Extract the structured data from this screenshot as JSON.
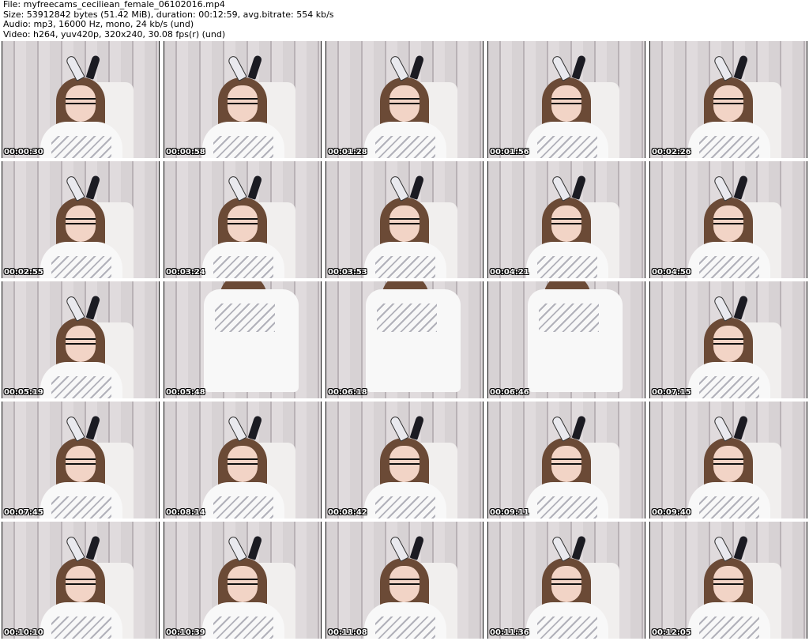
{
  "header": {
    "line1": "File: myfreecams_ceciliean_female_06102016.mp4",
    "line2": "Size: 53912842 bytes (51.42 MiB), duration: 00:12:59, avg.bitrate: 554 kb/s",
    "line3": "Audio: mp3, 16000 Hz, mono, 24 kb/s (und)",
    "line4": "Video: h264, yuv420p, 320x240, 30.08 fps(r) (und)"
  },
  "thumbnails": [
    {
      "time": "00:00:30",
      "pose": "seated"
    },
    {
      "time": "00:00:58",
      "pose": "seated"
    },
    {
      "time": "00:01:28",
      "pose": "seated"
    },
    {
      "time": "00:01:56",
      "pose": "seated"
    },
    {
      "time": "00:02:26",
      "pose": "seated"
    },
    {
      "time": "00:02:55",
      "pose": "seated"
    },
    {
      "time": "00:03:24",
      "pose": "seated"
    },
    {
      "time": "00:03:53",
      "pose": "seated"
    },
    {
      "time": "00:04:21",
      "pose": "seated"
    },
    {
      "time": "00:04:50",
      "pose": "seated"
    },
    {
      "time": "00:05:19",
      "pose": "seated"
    },
    {
      "time": "00:05:48",
      "pose": "standing"
    },
    {
      "time": "00:06:18",
      "pose": "standing"
    },
    {
      "time": "00:06:46",
      "pose": "standing"
    },
    {
      "time": "00:07:15",
      "pose": "seated"
    },
    {
      "time": "00:07:45",
      "pose": "seated"
    },
    {
      "time": "00:08:14",
      "pose": "seated"
    },
    {
      "time": "00:08:42",
      "pose": "seated"
    },
    {
      "time": "00:09:11",
      "pose": "seated"
    },
    {
      "time": "00:09:40",
      "pose": "seated"
    },
    {
      "time": "00:10:10",
      "pose": "seated"
    },
    {
      "time": "00:10:39",
      "pose": "seated"
    },
    {
      "time": "00:11:08",
      "pose": "seated"
    },
    {
      "time": "00:11:36",
      "pose": "seated"
    },
    {
      "time": "00:12:05",
      "pose": "seated"
    }
  ]
}
